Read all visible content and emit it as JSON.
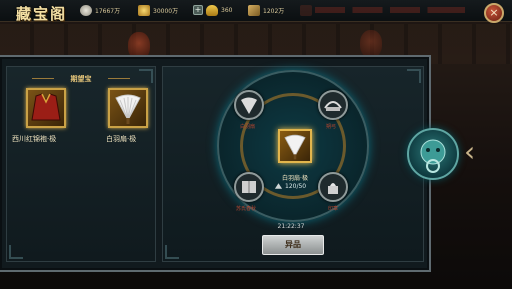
{
  "window": {
    "title": "藏宝阁"
  },
  "resources": {
    "silver": "17667万",
    "gold": "30000万",
    "yuanbao": "360",
    "token": "1202万"
  },
  "left_panel": {
    "title": "期望宝",
    "items": [
      {
        "label": "西川红锦袍·极"
      },
      {
        "label": "白羽扇·极"
      }
    ]
  },
  "wheel": {
    "nodes": [
      {
        "label": "白羽扇"
      },
      {
        "label": "朔弓"
      },
      {
        "label": "苏氏春秋"
      },
      {
        "label": "印章"
      }
    ],
    "center": {
      "name": "白羽扇·极",
      "progress": "120/50"
    },
    "timer": "21:22:37"
  },
  "buttons": {
    "main": "异品",
    "close": "×"
  },
  "icons": {
    "silver": "silver-coin-icon",
    "gold": "gold-coin-icon",
    "yuanbao": "yuanbao-icon",
    "token": "token-icon",
    "close": "close-icon",
    "knocker": "lion-door-knocker-icon",
    "arrow": "chevron-left-icon"
  }
}
